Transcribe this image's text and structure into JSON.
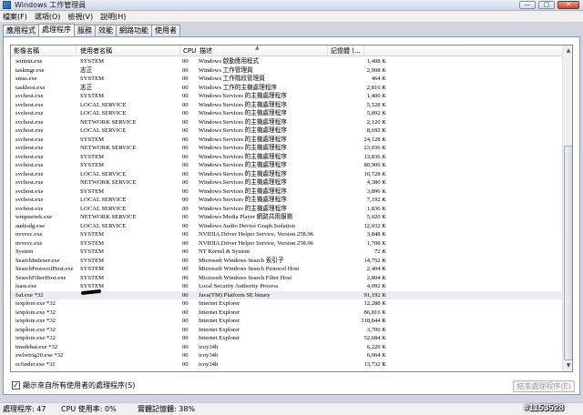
{
  "window": {
    "title": "Windows 工作管理員",
    "controls": {
      "minimize": "—",
      "maximize": "□",
      "close": "✕"
    }
  },
  "menu": [
    "檔案(F)",
    "選項(O)",
    "檢視(V)",
    "說明(H)"
  ],
  "tabs": [
    {
      "label": "應用程式",
      "active": false
    },
    {
      "label": "處理程序",
      "active": true
    },
    {
      "label": "服務",
      "active": false
    },
    {
      "label": "效能",
      "active": false
    },
    {
      "label": "網路功能",
      "active": false
    },
    {
      "label": "使用者",
      "active": false
    }
  ],
  "columns": {
    "name": "影像名稱",
    "user": "使用者名稱",
    "cpu": "CPU",
    "desc": "描述",
    "mem": "記憶體 (..."
  },
  "processes": [
    {
      "name": "wininit.exe",
      "user": "SYSTEM",
      "cpu": "00",
      "desc": "Windows 啟動應用程式",
      "mem": "1,408 K"
    },
    {
      "name": "taskmgr.exe",
      "user": "志正",
      "cpu": "00",
      "desc": "Windows 工作管理員",
      "mem": "2,908 K"
    },
    {
      "name": "smss.exe",
      "user": "SYSTEM",
      "cpu": "00",
      "desc": "Windows 工作階段管理員",
      "mem": "464 K"
    },
    {
      "name": "taskhost.exe",
      "user": "志正",
      "cpu": "00",
      "desc": "Windows 工作的主機處理程序",
      "mem": "2,816 K"
    },
    {
      "name": "svchost.exe",
      "user": "SYSTEM",
      "cpu": "00",
      "desc": "Windows Services 的主機處理程序",
      "mem": "1,400 K"
    },
    {
      "name": "svchost.exe",
      "user": "LOCAL SERVICE",
      "cpu": "00",
      "desc": "Windows Services 的主機處理程序",
      "mem": "5,528 K"
    },
    {
      "name": "svchost.exe",
      "user": "LOCAL SERVICE",
      "cpu": "00",
      "desc": "Windows Services 的主機處理程序",
      "mem": "5,892 K"
    },
    {
      "name": "svchost.exe",
      "user": "NETWORK SERVICE",
      "cpu": "00",
      "desc": "Windows Services 的主機處理程序",
      "mem": "2,120 K"
    },
    {
      "name": "svchost.exe",
      "user": "LOCAL SERVICE",
      "cpu": "00",
      "desc": "Windows Services 的主機處理程序",
      "mem": "8,692 K"
    },
    {
      "name": "svchost.exe",
      "user": "SYSTEM",
      "cpu": "00",
      "desc": "Windows Services 的主機處理程序",
      "mem": "24,128 K"
    },
    {
      "name": "svchost.exe",
      "user": "NETWORK SERVICE",
      "cpu": "00",
      "desc": "Windows Services 的主機處理程序",
      "mem": "23,036 K"
    },
    {
      "name": "svchost.exe",
      "user": "SYSTEM",
      "cpu": "00",
      "desc": "Windows Services 的主機處理程序",
      "mem": "13,836 K"
    },
    {
      "name": "svchost.exe",
      "user": "SYSTEM",
      "cpu": "00",
      "desc": "Windows Services 的主機處理程序",
      "mem": "80,900 K"
    },
    {
      "name": "svchost.exe",
      "user": "LOCAL SERVICE",
      "cpu": "00",
      "desc": "Windows Services 的主機處理程序",
      "mem": "10,728 K"
    },
    {
      "name": "svchost.exe",
      "user": "NETWORK SERVICE",
      "cpu": "00",
      "desc": "Windows Services 的主機處理程序",
      "mem": "4,380 K"
    },
    {
      "name": "svchost.exe",
      "user": "SYSTEM",
      "cpu": "00",
      "desc": "Windows Services 的主機處理程序",
      "mem": "3,896 K"
    },
    {
      "name": "svchost.exe",
      "user": "LOCAL SERVICE",
      "cpu": "00",
      "desc": "Windows Services 的主機處理程序",
      "mem": "7,192 K"
    },
    {
      "name": "svchost.exe",
      "user": "LOCAL SERVICE",
      "cpu": "00",
      "desc": "Windows Services 的主機處理程序",
      "mem": "1,836 K"
    },
    {
      "name": "wmpnetwk.exe",
      "user": "NETWORK SERVICE",
      "cpu": "00",
      "desc": "Windows Media Player 網路共用服務",
      "mem": "5,020 K"
    },
    {
      "name": "audiodg.exe",
      "user": "LOCAL SERVICE",
      "cpu": "00",
      "desc": "Windows Audio Device Graph Isolation",
      "mem": "12,032 K"
    },
    {
      "name": "nvvsvc.exe",
      "user": "SYSTEM",
      "cpu": "00",
      "desc": "NVIDIA Driver Helper Service, Version 258.96",
      "mem": "3,848 K"
    },
    {
      "name": "nvvsvc.exe",
      "user": "SYSTEM",
      "cpu": "00",
      "desc": "NVIDIA Driver Helper Service, Version 258.96",
      "mem": "1,708 K"
    },
    {
      "name": "System",
      "user": "SYSTEM",
      "cpu": "00",
      "desc": "NT Kernel & System",
      "mem": "72 K"
    },
    {
      "name": "SearchIndexer.exe",
      "user": "SYSTEM",
      "cpu": "00",
      "desc": "Microsoft Windows Search 索引子",
      "mem": "14,752 K"
    },
    {
      "name": "SearchProtocolHost.exe",
      "user": "SYSTEM",
      "cpu": "00",
      "desc": "Microsoft Windows Search Protocol Host",
      "mem": "2,404 K"
    },
    {
      "name": "SearchFilterHost.exe",
      "user": "SYSTEM",
      "cpu": "00",
      "desc": "Microsoft Windows Search Filter Host",
      "mem": "2,804 K"
    },
    {
      "name": "lsass.exe",
      "user": "SYSTEM",
      "cpu": "00",
      "desc": "Local Security Authority Process",
      "mem": "4,092 K"
    },
    {
      "name": "fsd.exe *32",
      "user": "",
      "cpu": "00",
      "desc": "Java(TM) Platform SE binary",
      "mem": "91,192 K",
      "selected": true
    },
    {
      "name": "iexplore.exe *32",
      "user": "",
      "cpu": "00",
      "desc": "Internet Explorer",
      "mem": "12,288 K"
    },
    {
      "name": "iexplore.exe *32",
      "user": "",
      "cpu": "00",
      "desc": "Internet Explorer",
      "mem": "86,816 K"
    },
    {
      "name": "iexplore.exe *32",
      "user": "",
      "cpu": "00",
      "desc": "Internet Explorer",
      "mem": "118,844 K"
    },
    {
      "name": "iexplore.exe *32",
      "user": "",
      "cpu": "00",
      "desc": "Internet Explorer",
      "mem": "3,700 K"
    },
    {
      "name": "iexplore.exe *32",
      "user": "",
      "cpu": "00",
      "desc": "Internet Explorer",
      "mem": "52,684 K"
    },
    {
      "name": "tmsdebar.exe *32",
      "user": "",
      "cpu": "00",
      "desc": "icoy34h",
      "mem": "6,220 K"
    },
    {
      "name": "zwlwtrig20.exe *32",
      "user": "",
      "cpu": "00",
      "desc": "icoy34h",
      "mem": "6,064 K"
    },
    {
      "name": "ecfinder.exe *32",
      "user": "",
      "cpu": "00",
      "desc": "icoy34h",
      "mem": "13,732 K"
    }
  ],
  "show_all_label": "顯示來自所有使用者的處理程序(S)",
  "show_all_checked": true,
  "end_process_label": "結束處理程序(E)",
  "status": {
    "processes": "處理程序: 47",
    "cpu": "CPU 使用率: 0%",
    "memory": "實體記憶體: 38%"
  },
  "watermark": "#1153528"
}
